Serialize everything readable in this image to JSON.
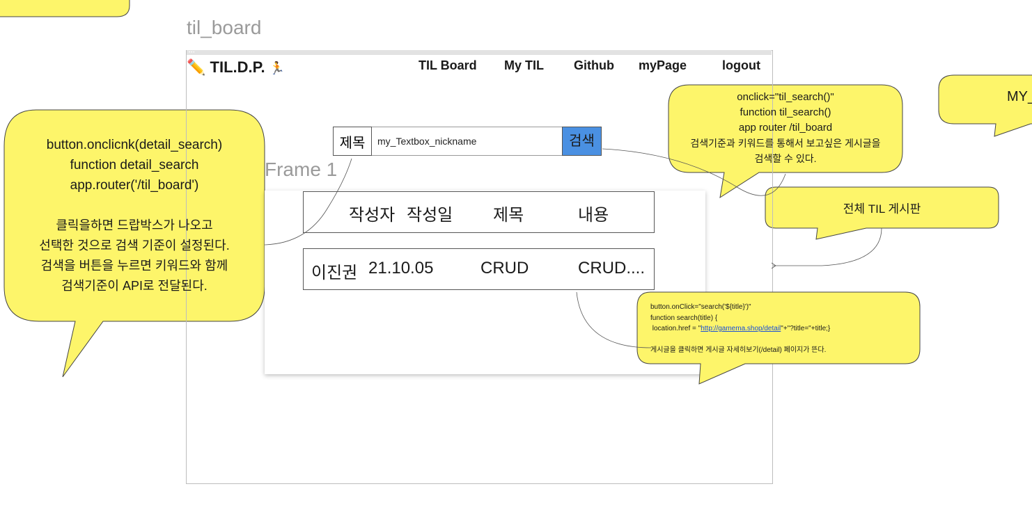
{
  "canvas": {
    "frame_title": "til_board",
    "frame1_label": "Frame 1"
  },
  "header": {
    "logo_icon": "✏️",
    "logo_text": "TIL.D.P.",
    "logo_runner": "🏃",
    "nav": [
      "TIL Board",
      "My TIL",
      "Github",
      "myPage",
      "logout"
    ]
  },
  "search": {
    "criterion": "제목",
    "input_value": "my_Textbox_nickname",
    "button_label": "검색"
  },
  "table": {
    "headers": [
      "작성자",
      "작성일",
      "제목",
      "내용"
    ],
    "rows": [
      [
        "이진권",
        "21.10.05",
        "CRUD",
        "CRUD...."
      ]
    ]
  },
  "notes": {
    "left": [
      "button.onclicnk(detail_search)",
      "function detail_search",
      "app.router('/til_board')",
      "",
      "클릭을하면 드랍박스가 나오고",
      "선택한 것으로 검색 기준이 설정된다.",
      "검색을 버튼을 누르면 키워드와 함께",
      "검색기준이 API로 전달된다."
    ],
    "search_note": [
      "onclick=\"til_search()\"",
      "function til_search()",
      "app router /til_board",
      "검색기준과 키워드를 통해서 보고싶은 게시글을",
      "검색할 수 있다."
    ],
    "board_note": "전체 TIL 게시판",
    "right_partial": "MY_",
    "detail_note": {
      "line1": "button.onClick=\"search('${title}')\"",
      "line2": "function search(title) {",
      "line3_prefix": " location.href = \"",
      "line3_link": "http://gamema.shop/detail",
      "line3_suffix": "\"+\"?title=\"+title;}",
      "line4": "게시글을 클릭하면 게시글 자세히보기(/detail) 페이지가 뜬다."
    }
  },
  "colors": {
    "note_yellow": "#fdf56a",
    "search_button": "#4a90e2"
  }
}
